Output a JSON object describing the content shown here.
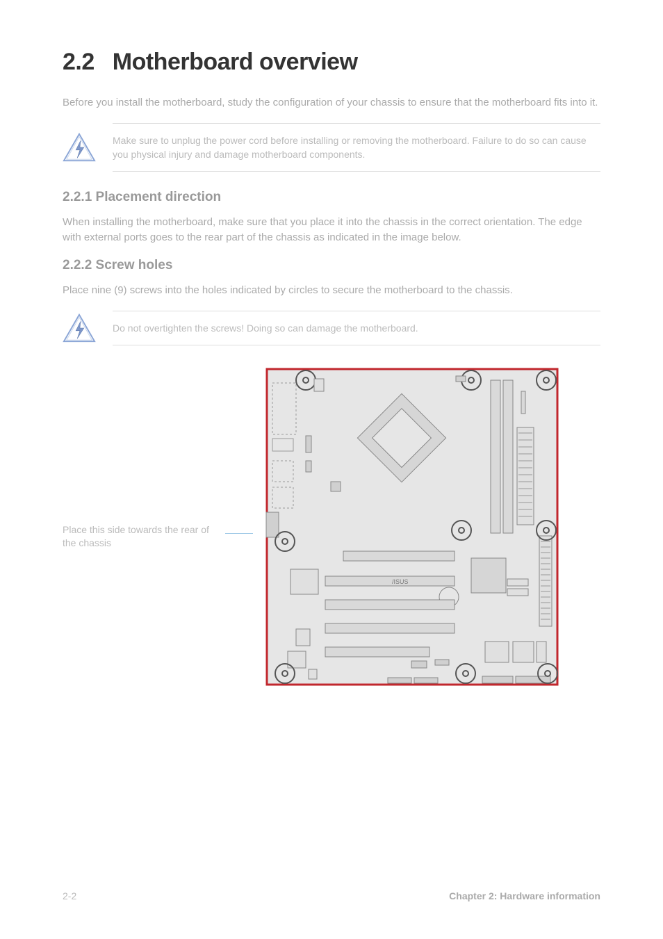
{
  "heading": {
    "number": "2.2",
    "title": "Motherboard overview"
  },
  "intro": "Before you install the motherboard, study the configuration of your chassis to ensure that the motherboard fits into it.",
  "callout1": "Make sure to unplug the power cord before installing or removing the motherboard. Failure to do so can cause you physical injury and damage motherboard components.",
  "sec221": {
    "num_title": "2.2.1   Placement direction",
    "para": "When installing the motherboard, make sure that you place it into the chassis in the correct orientation. The edge with external ports goes to the rear part of the chassis as indicated in the image below."
  },
  "sec222": {
    "num_title": "2.2.2   Screw holes",
    "para": "Place nine (9) screws into the holes indicated by circles to secure the motherboard to the chassis."
  },
  "callout2": "Do not overtighten the screws! Doing so can damage the motherboard.",
  "diagram_caption": "Place this side towards the rear of the chassis",
  "footer": {
    "left": "2-2",
    "right": "Chapter 2: Hardware information"
  },
  "icons": {
    "warning": "lightning-triangle"
  }
}
